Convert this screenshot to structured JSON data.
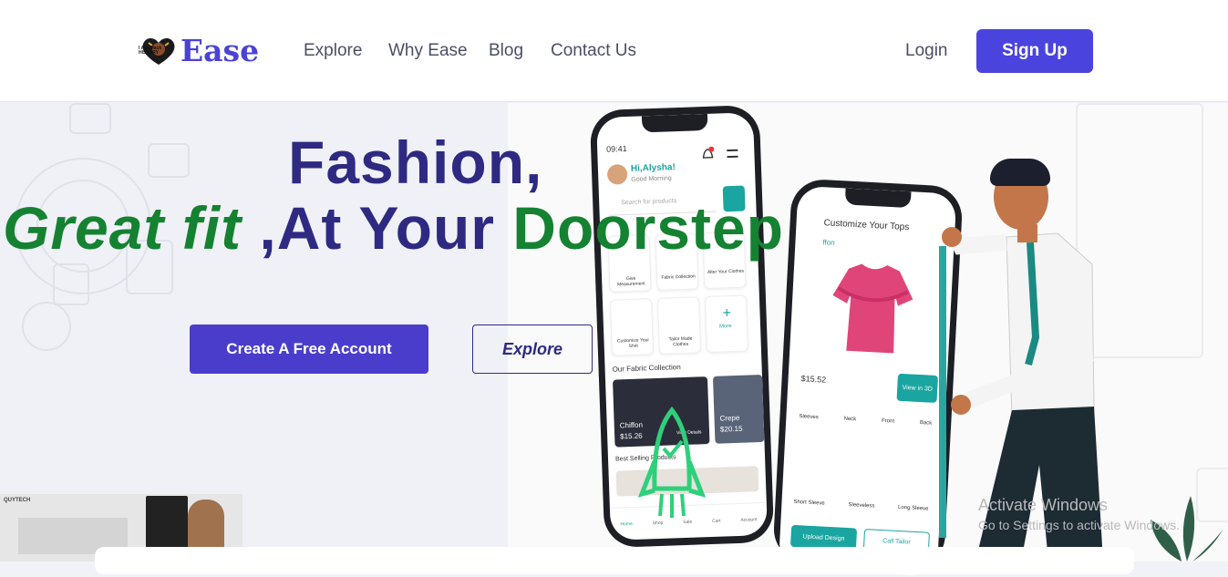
{
  "nav": {
    "logo_text": "Ease",
    "badge_text": "I AM Black HISTORY",
    "links": [
      "Explore",
      "Why Ease",
      "Blog",
      "Contact Us"
    ],
    "login": "Login",
    "signup": "Sign Up"
  },
  "hero": {
    "line1": "Fashion,",
    "line2_a": "Great fit ",
    "line2_b": ",At Your ",
    "line2_c": "Doorstep",
    "create_button": "Create A Free Account",
    "explore_button": "Explore"
  },
  "phone1": {
    "time": "09:41",
    "greeting": "Hi,Alysha!",
    "sub": "Good Morning",
    "search": "Search for products",
    "tiles": [
      "Give Measurement",
      "Fabric Collection",
      "Alter Your Clothes",
      "Customize Your Shirt",
      "Tailor Made Clothes",
      "More"
    ],
    "section": "Our Fabric Collection",
    "fabric1_name": "Chiffon",
    "fabric1_price": "$15.26",
    "fabric1_link": "View Details",
    "fabric2_name": "Crepe",
    "fabric2_price": "$20.15",
    "best": "Best Selling Products",
    "tabbar": [
      "Home",
      "Shop",
      "Sale",
      "Cart",
      "Account"
    ]
  },
  "phone2": {
    "title": "Customize Your Tops",
    "tag": "ffon",
    "price": "$15.52",
    "view3d": "View in 3D",
    "parts": [
      "Sleeves",
      "Neck",
      "Front",
      "Back"
    ],
    "styles": [
      "Short Sleeve",
      "Sleeveless",
      "Long Sleeve"
    ],
    "upload": "Upload Design",
    "call": "Call Tailor"
  },
  "thumb": {
    "label": "QUYTECH"
  },
  "watermark": {
    "title": "Activate Windows",
    "sub": "Go to Settings to activate Windows."
  },
  "colors": {
    "accent": "#4a43de",
    "navy": "#2e2a82",
    "green": "#158232",
    "teal": "#1aa5a0"
  }
}
